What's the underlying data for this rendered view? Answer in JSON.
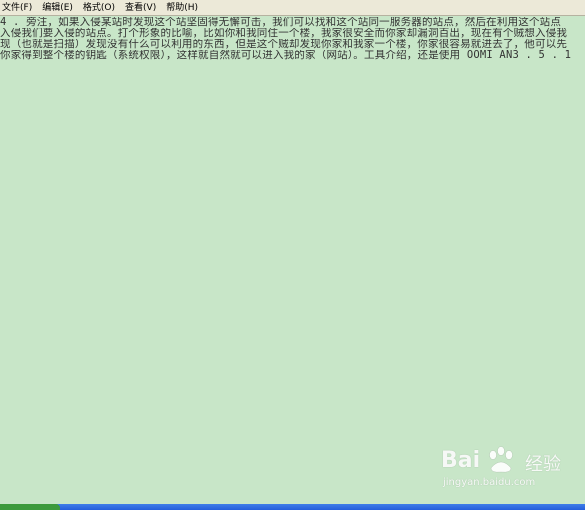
{
  "menu": {
    "items": [
      {
        "label": "文件(F)",
        "name": "menu-file"
      },
      {
        "label": "编辑(E)",
        "name": "menu-edit"
      },
      {
        "label": "格式(O)",
        "name": "menu-format"
      },
      {
        "label": "查看(V)",
        "name": "menu-view"
      },
      {
        "label": "帮助(H)",
        "name": "menu-help"
      }
    ]
  },
  "document": {
    "lines": [
      "4 . 旁注，如果入侵某站时发现这个站坚固得无懈可击，我们可以找和这个站同一服务器的站点，然后在利用这个站点",
      "入侵我们要入侵的站点。打个形象的比喻，比如你和我同住一个楼，我家很安全而你家却漏洞百出，现在有个贼想入侵我",
      "现（也就是扫描）发现没有什么可以利用的东西，但是这个贼却发现你家和我家一个楼，你家很容易就进去了，他可以先",
      "你家得到整个楼的钥匙（系统权限），这样就自然就可以进入我的家（网站）。工具介绍，还是使用 OOMI AN3 . 5 . 1"
    ]
  },
  "watermark": {
    "brand": "Bai",
    "jingyan": "经验",
    "url": "jingyan.baidu.com"
  }
}
